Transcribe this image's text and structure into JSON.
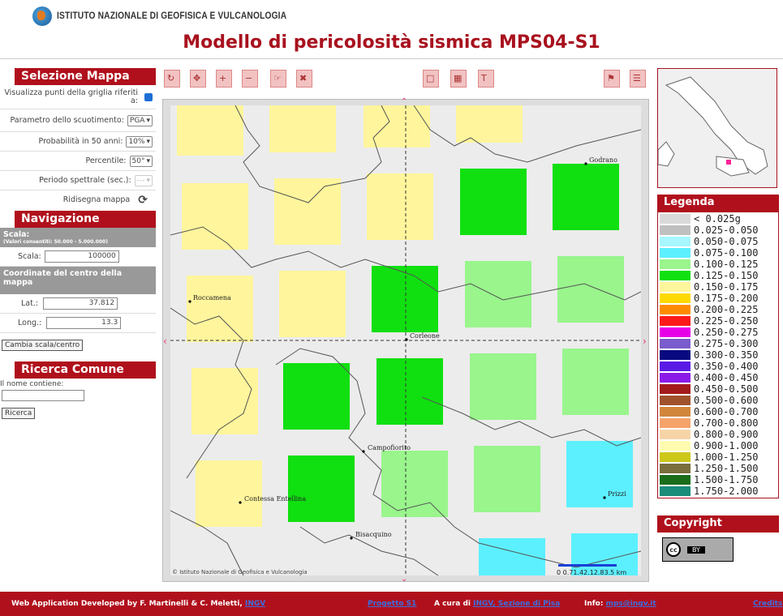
{
  "header": {
    "institution": "ISTITUTO NAZIONALE DI GEOFISICA E VULCANOLOGIA",
    "title": "Modello di pericolosità sismica MPS04-S1"
  },
  "sel": {
    "title": "Selezione Mappa",
    "points_label": "Visualizza punti della griglia riferiti a:",
    "param_label": "Parametro dello scuotimento:",
    "param_value": "PGA",
    "prob_label": "Probabilità in 50 anni:",
    "prob_value": "10%",
    "perc_label": "Percentile:",
    "perc_value": "50°",
    "period_label": "Periodo spettrale (sec.):",
    "period_value": "---",
    "redraw_label": "Ridisegna mappa"
  },
  "nav": {
    "title": "Navigazione",
    "scale_head": "Scala:",
    "scale_note": "(Valori consentiti: 50.000 - 5.000.000)",
    "scale_label": "Scala:",
    "scale_value": "100000",
    "coord_head": "Coordinate del centro della mappa",
    "lat_label": "Lat.:",
    "lat_value": "37.812",
    "lon_label": "Long.:",
    "lon_value": "13.3",
    "change_btn": "Cambia scala/centro"
  },
  "search": {
    "title": "Ricerca Comune",
    "label": "Il nome contiene:",
    "btn": "Ricerca"
  },
  "map": {
    "copyright": "© Istituto Nazionale di Geofisica e Vulcanologia",
    "scalebar": "0 0.71.42.12.83.5 km",
    "places": [
      "Godrano",
      "Roccamena",
      "Corleone",
      "Campofiorito",
      "Contessa Entellina",
      "Prizzi",
      "Bisacquino"
    ]
  },
  "legend": {
    "title": "Legenda",
    "items": [
      {
        "label": "< 0.025g",
        "color": "#d9d9d9"
      },
      {
        "label": "0.025-0.050",
        "color": "#bfbfbf"
      },
      {
        "label": "0.050-0.075",
        "color": "#a6f7ff"
      },
      {
        "label": "0.075-0.100",
        "color": "#5cf0ff"
      },
      {
        "label": "0.100-0.125",
        "color": "#99f58c"
      },
      {
        "label": "0.125-0.150",
        "color": "#10e010"
      },
      {
        "label": "0.150-0.175",
        "color": "#fff59c"
      },
      {
        "label": "0.175-0.200",
        "color": "#ffd900"
      },
      {
        "label": "0.200-0.225",
        "color": "#ff8c00"
      },
      {
        "label": "0.225-0.250",
        "color": "#ff1a1a"
      },
      {
        "label": "0.250-0.275",
        "color": "#e600e6"
      },
      {
        "label": "0.275-0.300",
        "color": "#7a5ccc"
      },
      {
        "label": "0.300-0.350",
        "color": "#0a0a80"
      },
      {
        "label": "0.350-0.400",
        "color": "#5a1ae6"
      },
      {
        "label": "0.400-0.450",
        "color": "#8c1ae6"
      },
      {
        "label": "0.450-0.500",
        "color": "#a31a1a"
      },
      {
        "label": "0.500-0.600",
        "color": "#a0522d"
      },
      {
        "label": "0.600-0.700",
        "color": "#d2863c"
      },
      {
        "label": "0.700-0.800",
        "color": "#f5a36b"
      },
      {
        "label": "0.800-0.900",
        "color": "#f7d4a8"
      },
      {
        "label": "0.900-1.000",
        "color": "#fffcb0"
      },
      {
        "label": "1.000-1.250",
        "color": "#cdc71a"
      },
      {
        "label": "1.250-1.500",
        "color": "#7a6e3c"
      },
      {
        "label": "1.500-1.750",
        "color": "#1a6e1a"
      },
      {
        "label": "1.750-2.000",
        "color": "#1a8c7a"
      }
    ]
  },
  "copyright": {
    "title": "Copyright",
    "badge": "BY"
  },
  "footer": {
    "dev": "Web Application Developed by F. Martinelli & C. Meletti,",
    "dev_link": "INGV",
    "prog": "Progetto S1",
    "cura": "A cura di",
    "cura_link": "INGV, Sezione di Pisa",
    "info": "Info:",
    "info_link": "mps@ingv.it",
    "credits": "Credits"
  }
}
